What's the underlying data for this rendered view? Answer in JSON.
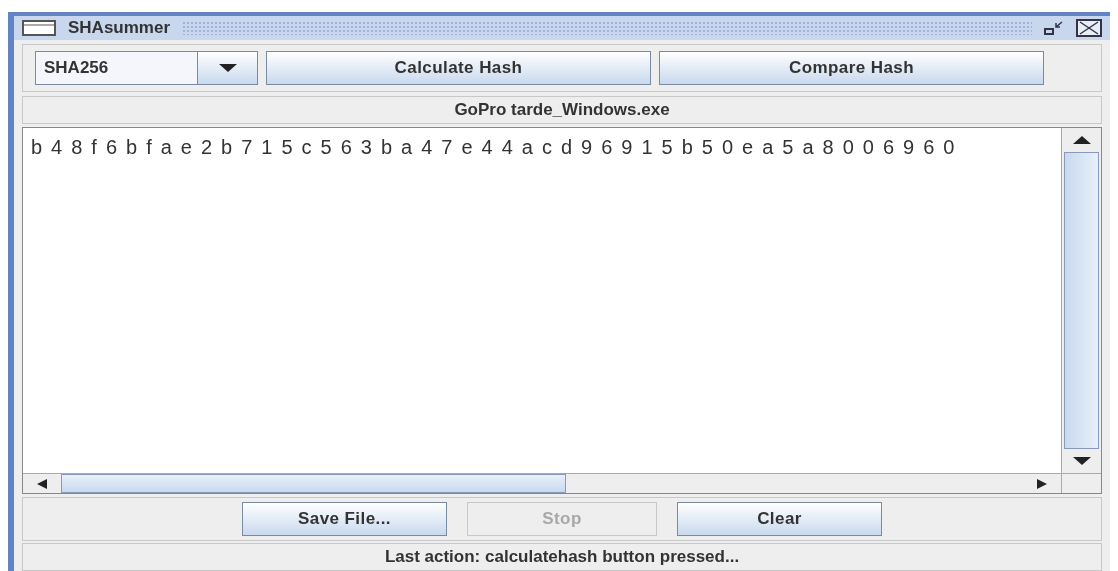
{
  "window": {
    "title": "SHAsummer"
  },
  "algorithm": {
    "value": "SHA256"
  },
  "toolbar_buttons": [
    {
      "label": "Calculate Hash",
      "disabled": false
    },
    {
      "label": "Compare Hash",
      "disabled": false
    }
  ],
  "file_name": "GoPro tarde_Windows.exe",
  "output": "b48f6bfae2b715c563ba47e44acd96915b50ea5a8006960",
  "bottom_buttons": [
    {
      "label": "Save File...",
      "disabled": false
    },
    {
      "label": "Stop",
      "disabled": true
    },
    {
      "label": "Clear",
      "disabled": false
    }
  ],
  "status_bar": "Last action: calculatehash button pressed..."
}
